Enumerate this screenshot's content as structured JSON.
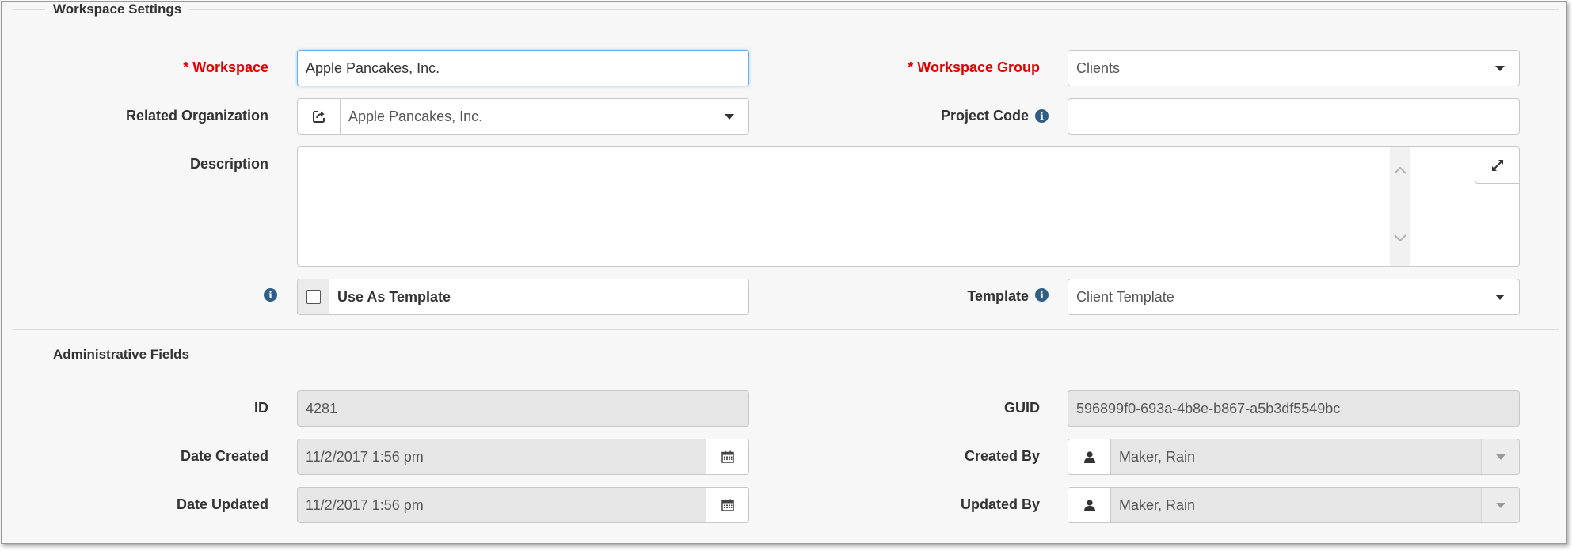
{
  "workspace_settings": {
    "legend": "Workspace Settings",
    "workspace": {
      "label": "* Workspace",
      "value": "Apple Pancakes, Inc."
    },
    "workspace_group": {
      "label": "* Workspace Group",
      "value": "Clients"
    },
    "related_organization": {
      "label": "Related Organization",
      "value": "Apple Pancakes, Inc."
    },
    "project_code": {
      "label": "Project Code",
      "value": ""
    },
    "description": {
      "label": "Description",
      "value": ""
    },
    "use_as_template": {
      "label": "Use As Template",
      "checked": false
    },
    "template": {
      "label": "Template",
      "value": "Client Template"
    }
  },
  "administrative_fields": {
    "legend": "Administrative Fields",
    "id": {
      "label": "ID",
      "value": "4281"
    },
    "guid": {
      "label": "GUID",
      "value": "596899f0-693a-4b8e-b867-a5b3df5549bc"
    },
    "date_created": {
      "label": "Date Created",
      "value": "11/2/2017 1:56 pm"
    },
    "created_by": {
      "label": "Created By",
      "value": "Maker, Rain"
    },
    "date_updated": {
      "label": "Date Updated",
      "value": "11/2/2017 1:56 pm"
    },
    "updated_by": {
      "label": "Updated By",
      "value": "Maker, Rain"
    }
  },
  "icons": {
    "info": "info-icon",
    "open_record": "open-external-icon",
    "expand": "expand-icon",
    "calendar": "calendar-icon",
    "user": "user-icon",
    "dropdown": "chevron-down-icon"
  },
  "colors": {
    "required_label": "#e00000",
    "info_icon": "#2f5f86",
    "focus_border": "#66afe9",
    "readonly_bg": "#e6e6e6"
  }
}
